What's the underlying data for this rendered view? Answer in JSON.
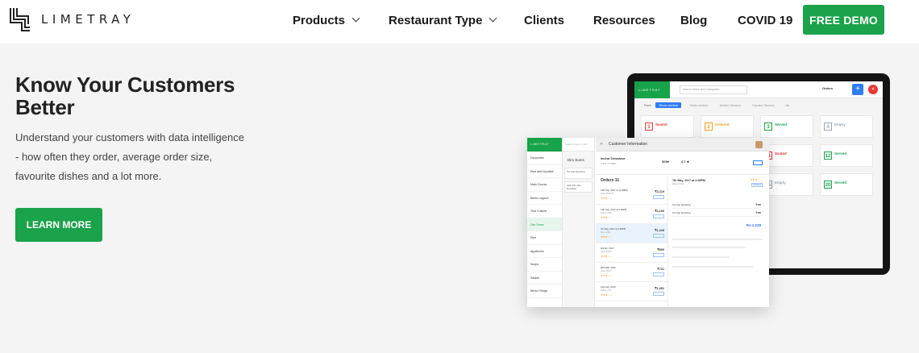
{
  "brand": {
    "name": "LIMETRAY"
  },
  "nav": {
    "items": [
      {
        "label": "Products",
        "has_dropdown": true
      },
      {
        "label": "Restaurant Type",
        "has_dropdown": true
      },
      {
        "label": "Clients",
        "has_dropdown": false
      },
      {
        "label": "Resources",
        "has_dropdown": false
      },
      {
        "label": "Blog",
        "has_dropdown": false
      },
      {
        "label": "COVID 19",
        "has_dropdown": false
      }
    ],
    "cta_label": "FREE DEMO"
  },
  "hero": {
    "title": "Know Your Customers Better",
    "description": "Understand your customers with data intelligence - how often they order, average order size, favourite dishes and a lot more.",
    "button_label": "LEARN MORE"
  },
  "colors": {
    "brand_green": "#1aa34a",
    "accent_blue": "#2e7cf6",
    "page_bg": "#f3f4f3"
  },
  "laptop_screen": {
    "logo": "LIMETRAY",
    "search_placeholder": "Search Items and Categories",
    "orders_label": "Orders",
    "plus_label": "+",
    "badge": "4",
    "filter_label": "Roof",
    "tabs": [
      "Show section",
      "Table section",
      "Mobile Section",
      "Garden Section",
      "All"
    ],
    "tables": [
      {
        "num": "1",
        "status": "Seated",
        "color": "#e53935"
      },
      {
        "num": "2",
        "status": "Ordered",
        "color": "#f0a01a"
      },
      {
        "num": "3",
        "status": "Served",
        "color": "#17a349"
      },
      {
        "num": "4",
        "status": "Empty",
        "color": "#9aa6b2"
      },
      {
        "num": "7",
        "status": "Served",
        "color": "#17a349"
      },
      {
        "num": "8",
        "status": "Ordered",
        "color": "#f0a01a"
      },
      {
        "num": "11",
        "status": "Seated",
        "color": "#e53935"
      },
      {
        "num": "12",
        "status": "Served",
        "color": "#17a349"
      },
      {
        "num": "15",
        "status": "Empty",
        "color": "#9aa6b2"
      },
      {
        "num": "16",
        "status": "Empty",
        "color": "#9aa6b2"
      },
      {
        "num": "15",
        "status": "Empty",
        "color": "#9aa6b2"
      },
      {
        "num": "20",
        "status": "Served",
        "color": "#17a349"
      }
    ]
  },
  "customer_window": {
    "sidebar_logo": "LIMETRAY",
    "categories": [
      "Favourites",
      "Rice and Noodles",
      "Main Course",
      "Bento Legend",
      "Thai Cuisine",
      "Dim Sums",
      "Rice",
      "Appetizers",
      "Soups",
      "Salads",
      "Bento Firings"
    ],
    "active_category_index": 5,
    "mid_search": "Search menu or dish",
    "mid_title": "Dim Sums",
    "mid_items": [
      "Tsu Kek Dumpling",
      "Jade Dim Sha Dumpling"
    ],
    "header_title": "Customer Information",
    "customer_name": "Imchai Srivastava",
    "customer_phone": "(+91) 7774887",
    "stats": [
      "509♥",
      "4.7 ★"
    ],
    "orders_title": "Orders 11",
    "orders": [
      {
        "date": "11th Aug, 2017 at 12:38PM",
        "sub": "Order #198476",
        "stars": "★★★☆☆",
        "amount": "₹2,119"
      },
      {
        "date": "11th Aug, 2017 at 3:00PM",
        "sub": "Delivery #98",
        "stars": "★★★☆☆",
        "amount": "₹4,193"
      },
      {
        "date": "7th May, 2017 at 4:05PM",
        "sub": "Dine-in #01",
        "stars": "★★★☆☆",
        "amount": "₹1,228"
      },
      {
        "date": "3rd Apr, 2017",
        "sub": "Order #7623",
        "stars": "★★★☆☆",
        "amount": "₹800"
      },
      {
        "date": "20th Mar, 2016",
        "sub": "Order #5514",
        "stars": "★★★☆☆",
        "amount": "₹721"
      },
      {
        "date": "21st Feb, 2016",
        "sub": "Delivery #12",
        "stars": "★★★☆☆",
        "amount": "₹1,451"
      }
    ],
    "selected_order_index": 2,
    "detail_title": "7th May, 2017 at 2:05PM",
    "detail_sub": "Dine-in T-14",
    "detail_stars": "★★★☆☆",
    "feedback_label": "Feedback",
    "items": [
      {
        "name": "Tsu Kek Dumpling",
        "price": "₹408"
      },
      {
        "name": "Tsu Kek Dumpling",
        "price": "₹408"
      }
    ],
    "total": "Rs.1,228"
  }
}
